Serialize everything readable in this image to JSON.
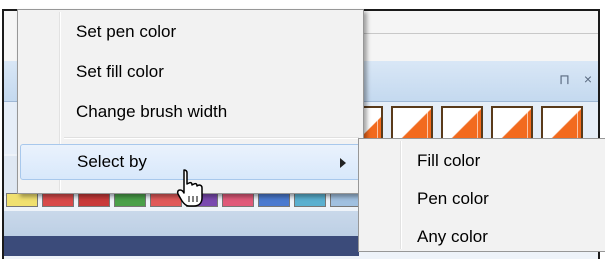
{
  "context_menu": {
    "items": [
      {
        "label": "Set pen color"
      },
      {
        "label": "Set fill color"
      },
      {
        "label": "Change brush width"
      },
      {
        "label": "Select by",
        "has_submenu": true,
        "highlighted": true
      }
    ]
  },
  "submenu": {
    "items": [
      {
        "label": "Fill color"
      },
      {
        "label": "Pen color"
      },
      {
        "label": "Any color"
      }
    ]
  },
  "panel": {
    "pin_glyph": "ᄆ",
    "close_glyph": "×"
  },
  "colors": {
    "menu_bg": "#f2f2f2",
    "highlight": "#d8e8fb",
    "swatch_orange": "#f26a1e"
  },
  "icons": [
    "chevron-right-icon",
    "hand-cursor-icon",
    "pin-icon",
    "close-icon"
  ]
}
